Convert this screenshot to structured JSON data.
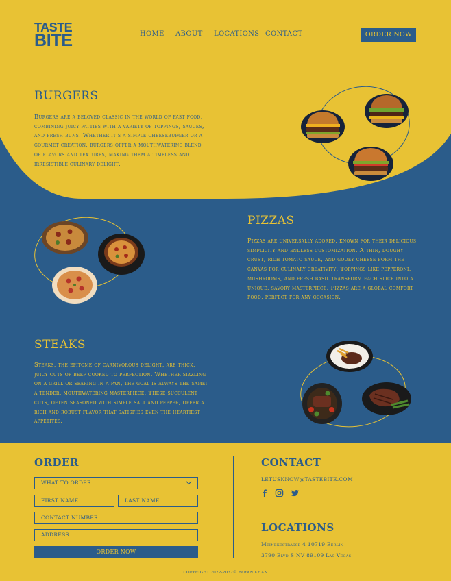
{
  "header": {
    "logo_line1": "TASTE",
    "logo_line2": "BITE",
    "nav": [
      "HOME",
      "ABOUT",
      "LOCATIONS",
      "CONTACT"
    ],
    "order_button": "ORDER NOW"
  },
  "sections": {
    "burgers": {
      "title": "BURGERS",
      "text": "Burgers are a beloved classic in the world of fast food, combining juicy patties with a variety of toppings, sauces, and fresh buns. Whether it's a simple cheeseburger or a gourmet creation, burgers offer a mouthwatering blend of flavors and textures, making them a timeless and irresistible culinary delight."
    },
    "pizzas": {
      "title": "PIZZAS",
      "text": "Pizzas are universally adored, known for their delicious simplicity and endless customization. A thin, doughy crust, rich tomato sauce, and gooey cheese form the canvas for culinary creativity. Toppings like pepperoni, mushrooms, and fresh basil transform each slice into a unique, savory masterpiece. Pizzas are a global comfort food, perfect for any occasion."
    },
    "steaks": {
      "title": "STEAKS",
      "text": "Steaks, the epitome of carnivorous delight, are thick, juicy cuts of beef cooked to perfection. Whether sizzling on a grill or searing in a pan, the goal is always the same: a tender, mouthwatering masterpiece. These succulent cuts, often seasoned with simple salt and pepper, offer a rich and robust flavor that satisfies even the heartiest appetites."
    }
  },
  "order_form": {
    "title": "ORDER",
    "select_placeholder": "WHAT TO ORDER",
    "first_name_placeholder": "FIRST NAME",
    "last_name_placeholder": "LAST NAME",
    "contact_placeholder": "CONTACT NUMBER",
    "address_placeholder": "ADDRESS",
    "submit_label": "ORDER NOW"
  },
  "contact": {
    "title": "CONTACT",
    "email": "LETUSKNOW@TASTEBITE.COM",
    "social_icons": [
      "facebook-icon",
      "instagram-icon",
      "twitter-icon"
    ]
  },
  "locations": {
    "title": "LOCATIONS",
    "items": [
      "Meinekestrasse 4 10719 Berlin",
      "3790 Blvd S NV 89109 Las Vegas"
    ]
  },
  "footer": {
    "copyright": "COPYRIGHT 2022-2032© FARAN KHAN"
  },
  "colors": {
    "yellow": "#e8c234",
    "blue": "#2b5c8a"
  }
}
